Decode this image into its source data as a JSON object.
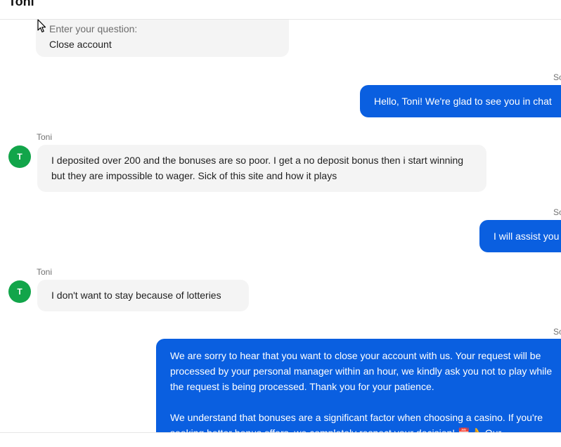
{
  "header": {
    "title": "Toni"
  },
  "messages": {
    "form": {
      "label": "Enter your question:",
      "value": "Close account"
    },
    "m1": {
      "sender": "So",
      "text": "Hello, Toni! We're glad to see you in chat"
    },
    "m2": {
      "sender": "Toni",
      "avatar": "T",
      "text": "I deposited over 200 and the bonuses are so poor. I get a no deposit bonus then i start winning but they are impossible to wager. Sick of this site and how it plays"
    },
    "m3": {
      "sender": "So",
      "text": "I will assist you"
    },
    "m4": {
      "sender": "Toni",
      "avatar": "T",
      "text": "I don't want to stay because of lotteries"
    },
    "m5": {
      "sender": "So",
      "p1": "We are sorry to hear that you want to close your account with us. Your request will be processed by your personal manager within an hour, we kindly ask you not to play while the request is being processed. Thank you for your patience.",
      "p2": "We understand that bonuses are a significant factor when choosing a casino. If you're seeking better bonus offers, we completely respect your decision! 📅👌 Our"
    }
  },
  "colors": {
    "agent_bubble": "#0a5fe0",
    "user_bubble": "#f4f4f4",
    "avatar": "#12a54a"
  }
}
